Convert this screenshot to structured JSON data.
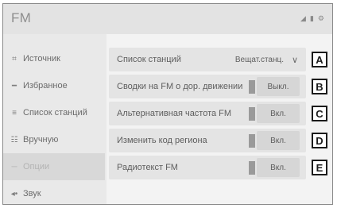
{
  "header": {
    "title": "FM"
  },
  "status_icons": [
    "signal-icon",
    "battery-icon",
    "gear-icon"
  ],
  "sidebar": {
    "items": [
      {
        "label": "Источник",
        "icon": "source-icon",
        "active": false
      },
      {
        "label": "Избранное",
        "icon": "favorites-icon",
        "active": false
      },
      {
        "label": "Список станций",
        "icon": "station-list-icon",
        "active": false
      },
      {
        "label": "Вручную",
        "icon": "manual-icon",
        "active": false
      },
      {
        "label": "Опции",
        "icon": "options-icon",
        "active": true
      },
      {
        "label": "Звук",
        "icon": "sound-icon",
        "active": false
      }
    ]
  },
  "settings": {
    "rows": [
      {
        "label": "Список станций",
        "value": "Вещат.станц.",
        "callout": "A"
      },
      {
        "label": "Сводки на FM о дор. движении",
        "value": "Выкл.",
        "callout": "B"
      },
      {
        "label": "Альтернативная частота FM",
        "value": "Вкл.",
        "callout": "C"
      },
      {
        "label": "Изменить код региона",
        "value": "Вкл.",
        "callout": "D"
      },
      {
        "label": "Радиотекст FM",
        "value": "Вкл.",
        "callout": "E"
      }
    ]
  }
}
